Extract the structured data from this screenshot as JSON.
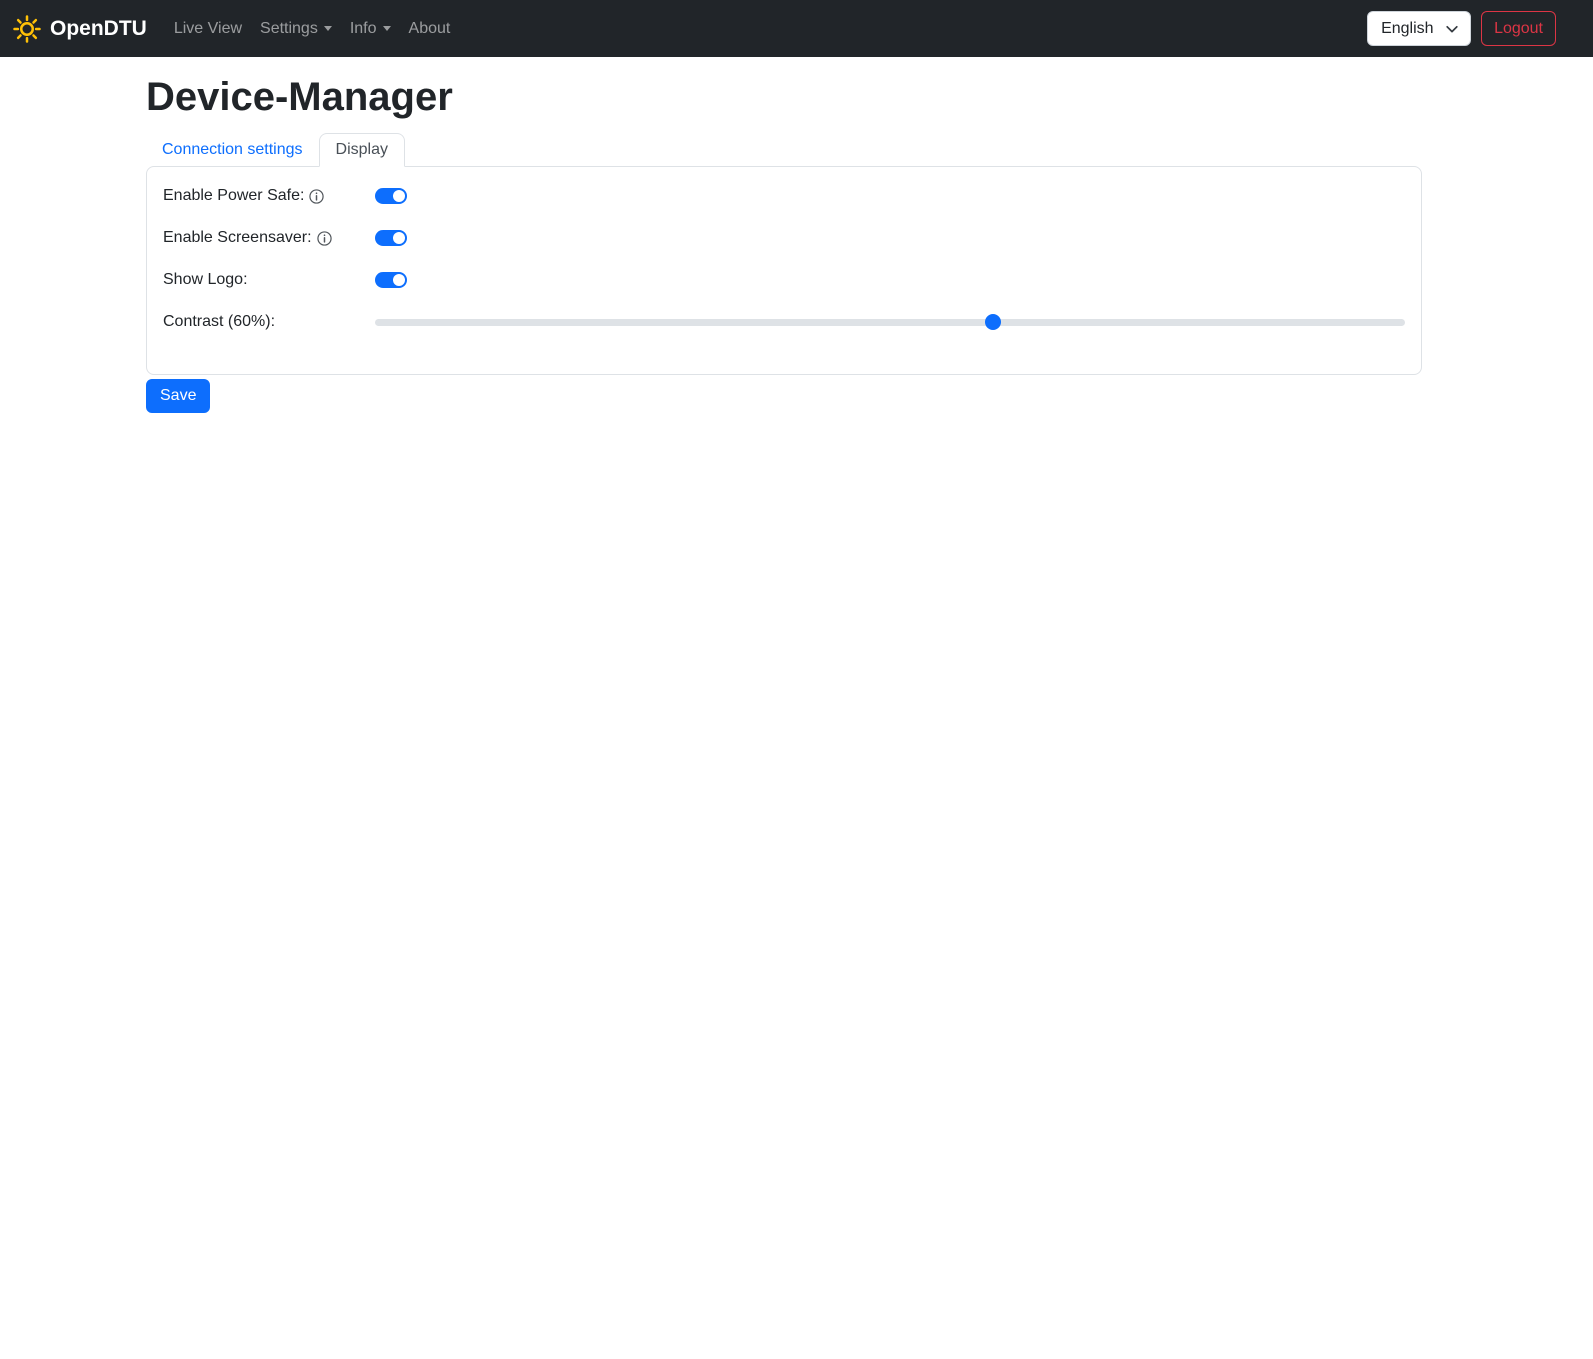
{
  "navbar": {
    "brand": "OpenDTU",
    "items": [
      {
        "label": "Live View",
        "dropdown": false
      },
      {
        "label": "Settings",
        "dropdown": true
      },
      {
        "label": "Info",
        "dropdown": true
      },
      {
        "label": "About",
        "dropdown": false
      }
    ],
    "language_selected": "English",
    "logout_label": "Logout"
  },
  "page": {
    "title": "Device-Manager"
  },
  "tabs": [
    {
      "label": "Connection settings",
      "active": false
    },
    {
      "label": "Display",
      "active": true
    }
  ],
  "form": {
    "rows": [
      {
        "label": "Enable Power Safe:",
        "info_icon": true,
        "type": "switch",
        "value": true
      },
      {
        "label": "Enable Screensaver:",
        "info_icon": true,
        "type": "switch",
        "value": true
      },
      {
        "label": "Show Logo:",
        "info_icon": false,
        "type": "switch",
        "value": true
      },
      {
        "label": "Contrast (60%):",
        "info_icon": false,
        "type": "range",
        "value": 60
      }
    ],
    "contrast_percent": 60,
    "save_label": "Save"
  },
  "colors": {
    "navbar_bg": "#212529",
    "brand_icon": "#ffc107",
    "primary": "#0d6efd",
    "danger": "#dc3545",
    "card_border": "#dee2e6",
    "tab_link": "#0d6efd",
    "active_tab_text": "#495057",
    "range_track": "#dee2e6"
  }
}
